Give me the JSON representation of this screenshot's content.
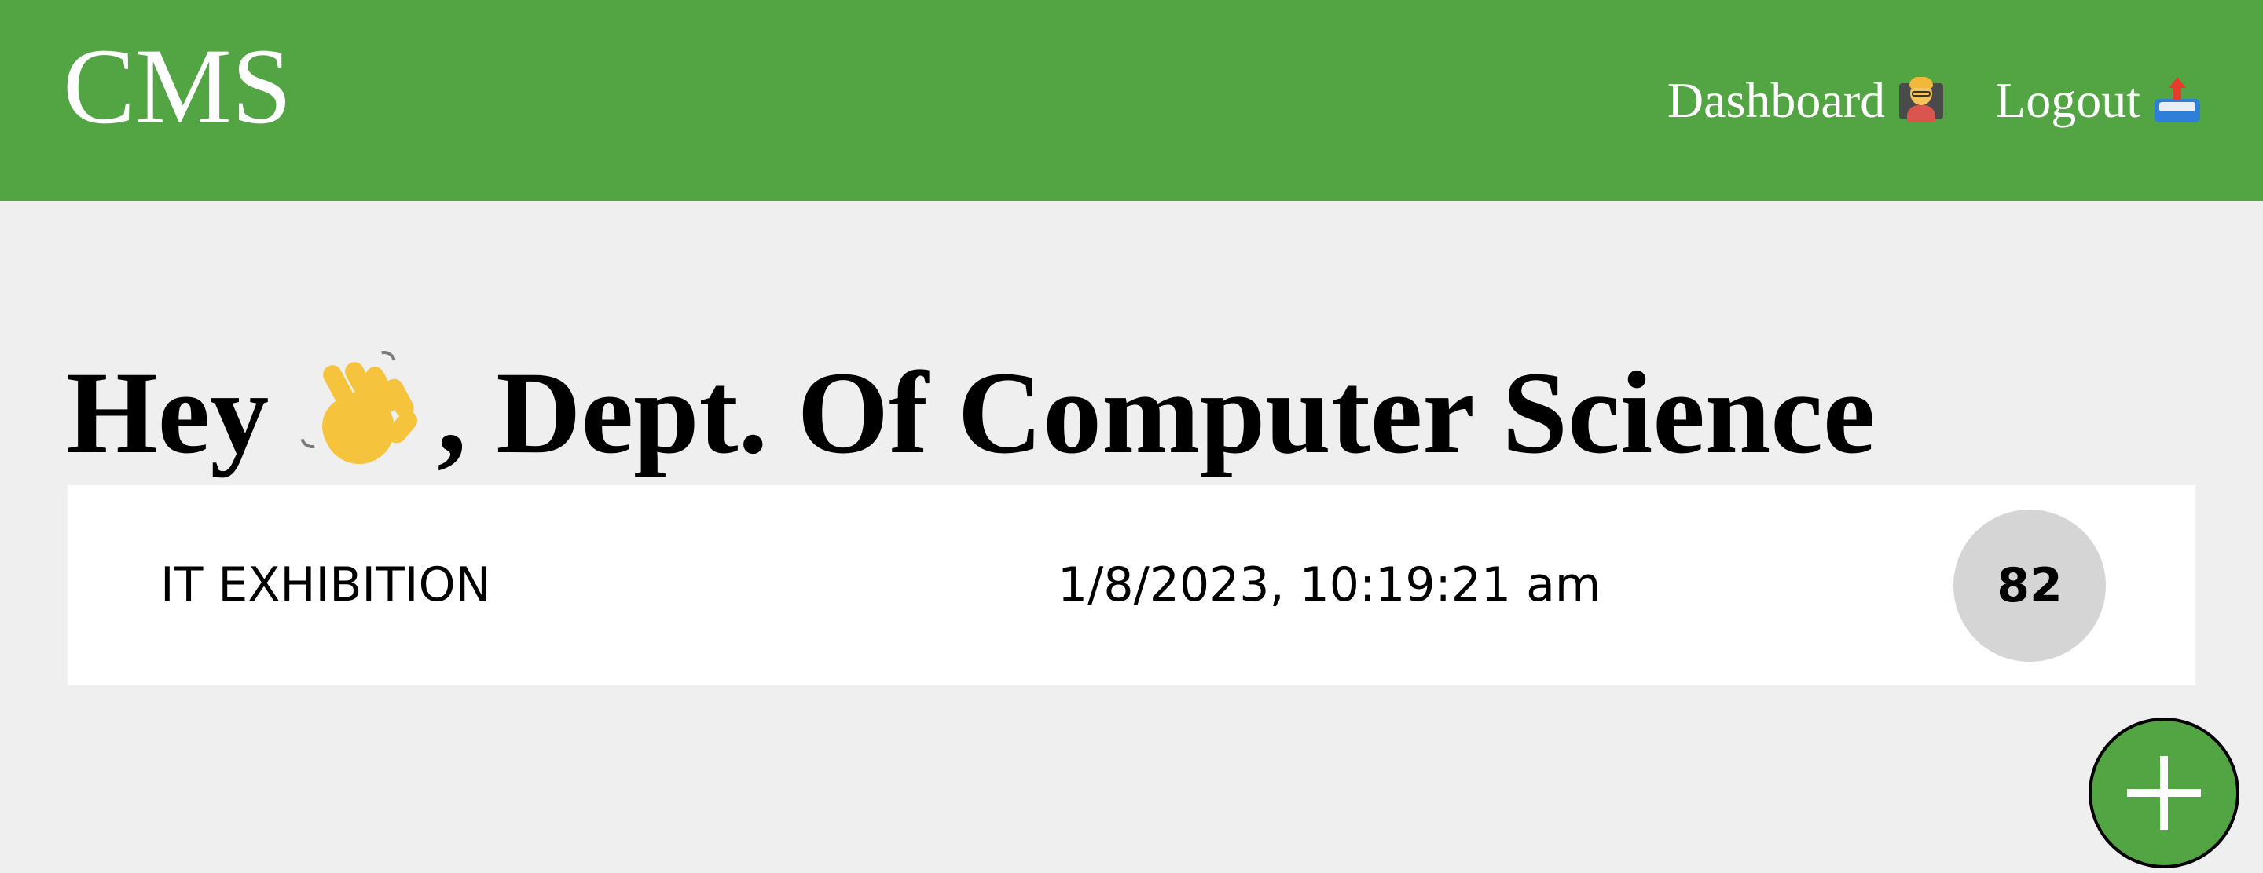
{
  "header": {
    "brand": "CMS",
    "nav": {
      "dashboard_label": "Dashboard",
      "dashboard_icon": "teacher-icon",
      "logout_label": "Logout",
      "logout_icon": "outbox-tray-icon"
    }
  },
  "main": {
    "greeting_prefix": "Hey",
    "greeting_icon": "waving-hand-icon",
    "greeting_suffix": ", Dept. Of Computer Science",
    "events": [
      {
        "title": "IT EXHIBITION",
        "datetime": "1/8/2023, 10:19:21 am",
        "count": "82"
      }
    ]
  },
  "fab": {
    "icon": "plus-icon"
  },
  "colors": {
    "primary_green": "#53a543",
    "background": "#efefef",
    "card_background": "#ffffff",
    "badge_background": "#d5d5d5"
  }
}
